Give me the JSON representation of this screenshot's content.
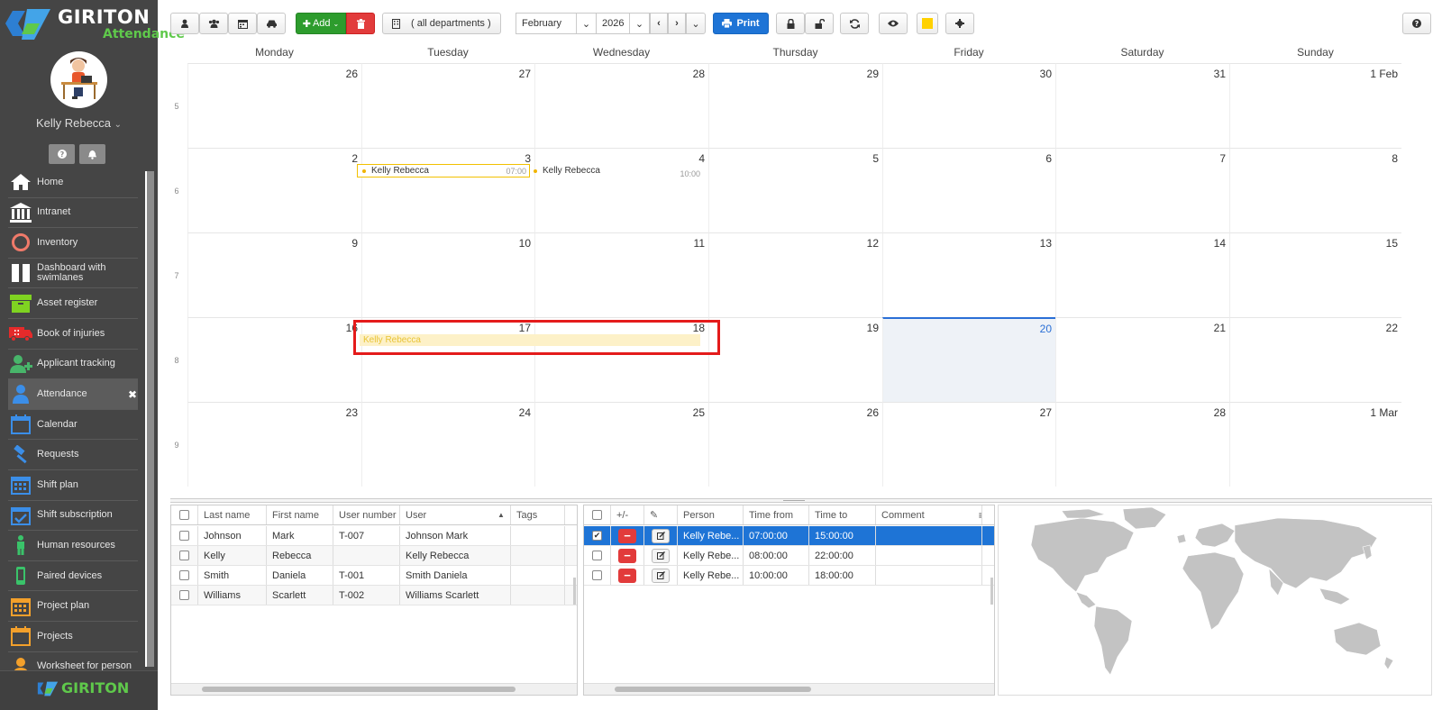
{
  "brand": {
    "title": "GIRITON",
    "subtitle": "Attendance",
    "footer_text": "GIRITON",
    "green": "#5fc94b"
  },
  "user": {
    "name": "Kelly Rebecca"
  },
  "nav": [
    {
      "label": "Home",
      "icon": "home-icon"
    },
    {
      "label": "Intranet",
      "icon": "bank-icon"
    },
    {
      "label": "Inventory",
      "icon": "circle-icon"
    },
    {
      "label": "Dashboard with swimlanes",
      "icon": "columns-icon"
    },
    {
      "label": "Asset register",
      "icon": "box-icon"
    },
    {
      "label": "Book of injuries",
      "icon": "ambulance-icon"
    },
    {
      "label": "Applicant tracking",
      "icon": "user-plus-icon"
    },
    {
      "label": "Attendance",
      "icon": "user-icon",
      "active": true,
      "close": "✖"
    },
    {
      "label": "Calendar",
      "icon": "calendar-icon"
    },
    {
      "label": "Requests",
      "icon": "gavel-icon"
    },
    {
      "label": "Shift plan",
      "icon": "calendar-grid-icon"
    },
    {
      "label": "Shift subscription",
      "icon": "calendar-check-icon"
    },
    {
      "label": "Human resources",
      "icon": "person-icon"
    },
    {
      "label": "Paired devices",
      "icon": "phone-icon"
    },
    {
      "label": "Project plan",
      "icon": "calendar-grid-icon"
    },
    {
      "label": "Projects",
      "icon": "calendar-icon"
    },
    {
      "label": "Worksheet for person",
      "icon": "user-icon"
    }
  ],
  "toolbar": {
    "add_label": "Add",
    "departments_label": "( all departments )",
    "month": "February",
    "year": "2026",
    "print_label": "Print",
    "color_swatch": "#ffd100"
  },
  "calendar": {
    "days": [
      "Monday",
      "Tuesday",
      "Wednesday",
      "Thursday",
      "Friday",
      "Saturday",
      "Sunday"
    ],
    "weeks": [
      {
        "num": "5",
        "dates": [
          "26",
          "27",
          "28",
          "29",
          "30",
          "31",
          "1 Feb"
        ]
      },
      {
        "num": "6",
        "dates": [
          "2",
          "3",
          "4",
          "5",
          "6",
          "7",
          "8"
        ]
      },
      {
        "num": "7",
        "dates": [
          "9",
          "10",
          "11",
          "12",
          "13",
          "14",
          "15"
        ]
      },
      {
        "num": "8",
        "dates": [
          "16",
          "17",
          "18",
          "19",
          "20",
          "21",
          "22"
        ]
      },
      {
        "num": "9",
        "dates": [
          "23",
          "24",
          "25",
          "26",
          "27",
          "28",
          "1 Mar"
        ]
      }
    ],
    "today": "20",
    "events": [
      {
        "name": "Kelly Rebecca",
        "time": "07:00"
      },
      {
        "name": "Kelly Rebecca",
        "time": "10:00"
      },
      {
        "name": "Kelly Rebecca",
        "time": ""
      }
    ],
    "today_color": "#2a6fd6",
    "event_color": "#f2c100"
  },
  "people_table": {
    "columns": [
      "Last name",
      "First name",
      "User number",
      "User",
      "Tags"
    ],
    "rows": [
      [
        "Johnson",
        "Mark",
        "T-007",
        "Johnson Mark",
        ""
      ],
      [
        "Kelly",
        "Rebecca",
        "",
        "Kelly Rebecca",
        ""
      ],
      [
        "Smith",
        "Daniela",
        "T-001",
        "Smith Daniela",
        ""
      ],
      [
        "Williams",
        "Scarlett",
        "T-002",
        "Williams Scarlett",
        ""
      ]
    ]
  },
  "attendance_table": {
    "columns": [
      "+/-",
      "✎",
      "Person",
      "Time from",
      "Time to",
      "Comment"
    ],
    "rows": [
      {
        "person": "Kelly Rebe...",
        "from": "07:00:00",
        "to": "15:00:00",
        "comment": "",
        "checked": true
      },
      {
        "person": "Kelly Rebe...",
        "from": "08:00:00",
        "to": "22:00:00",
        "comment": "",
        "checked": false
      },
      {
        "person": "Kelly Rebe...",
        "from": "10:00:00",
        "to": "18:00:00",
        "comment": "",
        "checked": false
      }
    ]
  }
}
